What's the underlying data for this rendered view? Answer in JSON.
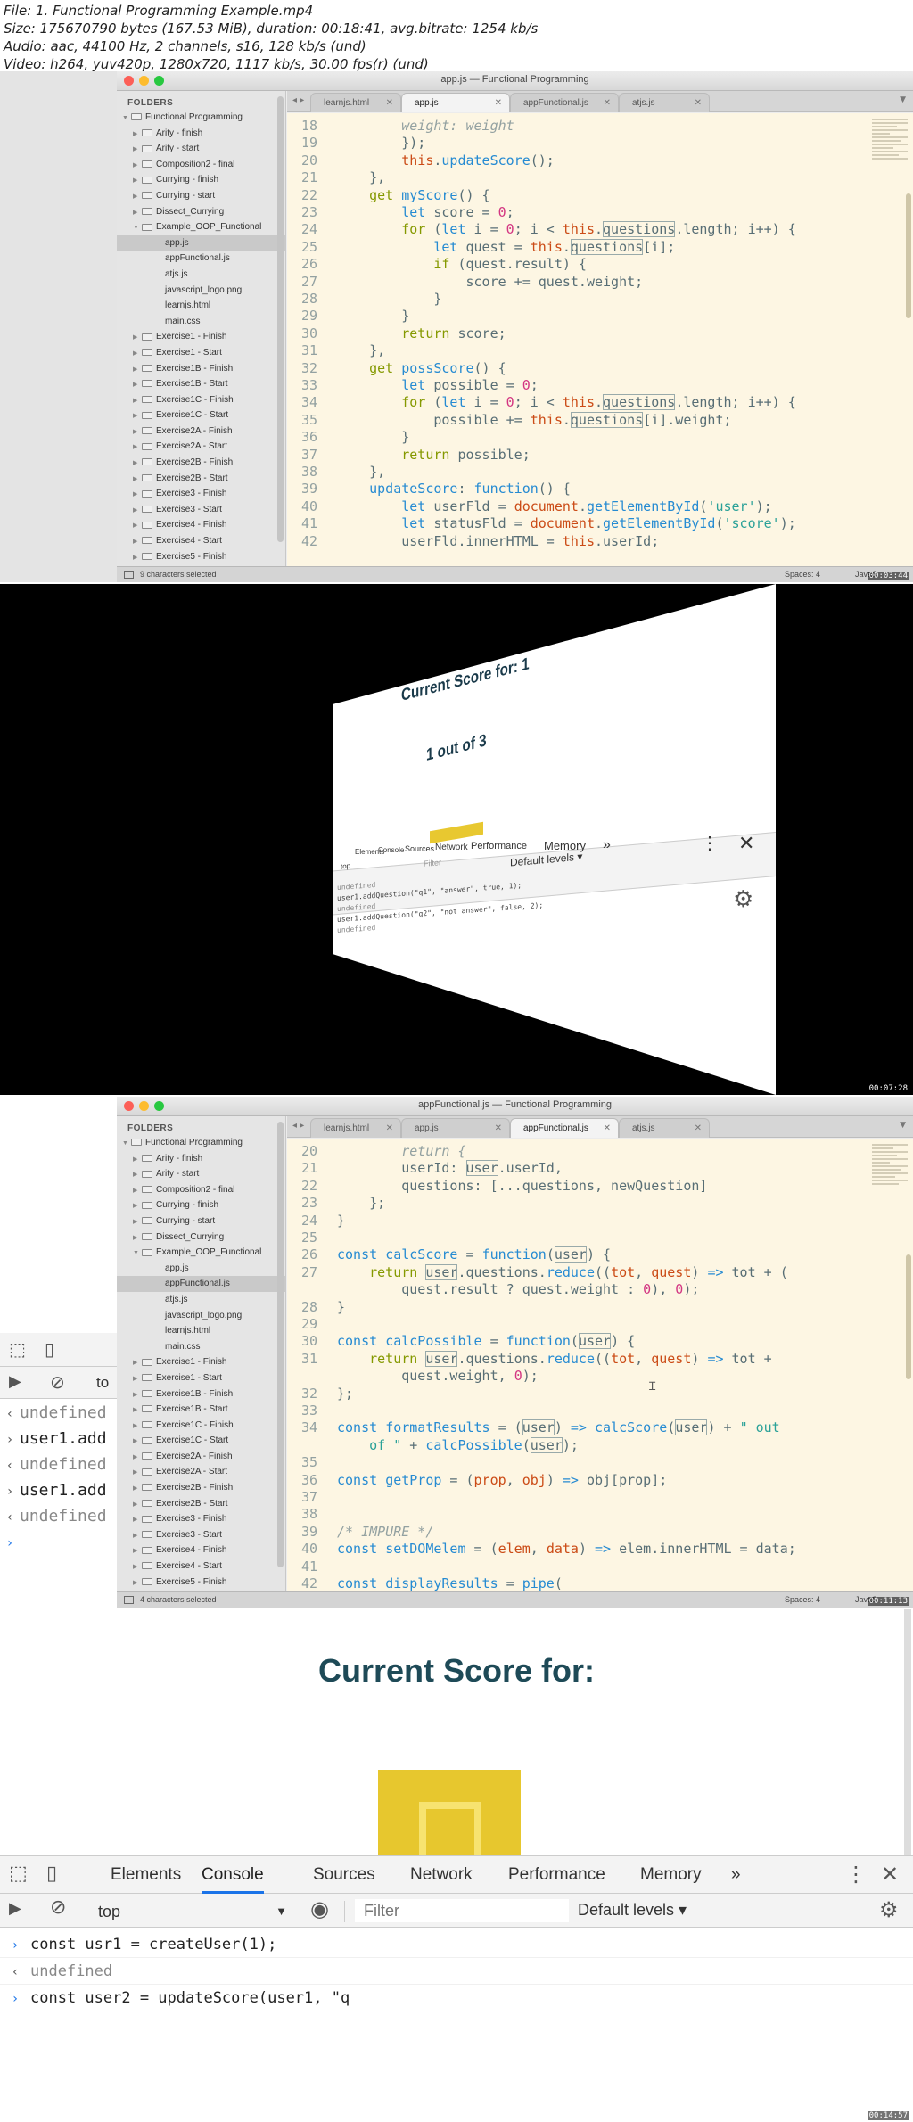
{
  "file_info": [
    "File: 1. Functional Programming Example.mp4",
    "Size: 175670790 bytes (167.53 MiB), duration: 00:18:41, avg.bitrate: 1254 kb/s",
    "Audio: aac, 44100 Hz, 2 channels, s16, 128 kb/s (und)",
    "Video: h264, yuv420p, 1280x720, 1117 kb/s, 30.00 fps(r) (und)"
  ],
  "sidebar": {
    "header": "FOLDERS",
    "root": "Functional Programming",
    "folders_before": [
      "Arity - finish",
      "Arity - start",
      "Composition2 - final",
      "Currying - finish",
      "Currying - start",
      "Dissect_Currying",
      "Example_OOP_Functional"
    ],
    "example_files": [
      "app.js",
      "appFunctional.js",
      "atjs.js",
      "javascript_logo.png",
      "learnjs.html",
      "main.css"
    ],
    "folders_after": [
      "Exercise1 - Finish",
      "Exercise1 - Start",
      "Exercise1B - Finish",
      "Exercise1B - Start",
      "Exercise1C - Finish",
      "Exercise1C - Start",
      "Exercise2A - Finish",
      "Exercise2A - Start",
      "Exercise2B - Finish",
      "Exercise2B - Start",
      "Exercise3 - Finish",
      "Exercise3 - Start",
      "Exercise4 - Finish",
      "Exercise4 - Start",
      "Exercise5 - Finish"
    ]
  },
  "editor1": {
    "title": "app.js — Functional Programming",
    "tabs": [
      "learnjs.html",
      "app.js",
      "appFunctional.js",
      "atjs.js"
    ],
    "active_tab": 1,
    "selected_file": "app.js",
    "status_left": "9 characters selected",
    "status_spaces": "Spaces: 4",
    "status_syntax": "JavaS",
    "lines": [
      [
        [
          "ln",
          "18"
        ],
        [
          "nm",
          "        "
        ],
        [
          "cm",
          "weight: weight"
        ]
      ],
      [
        [
          "ln",
          "19"
        ],
        [
          "nm",
          "        });"
        ]
      ],
      [
        [
          "ln",
          "20"
        ],
        [
          "nm",
          "        "
        ],
        [
          "t",
          "this"
        ],
        [
          "nm",
          "."
        ],
        [
          "fn",
          "updateScore"
        ],
        [
          "nm",
          "();"
        ]
      ],
      [
        [
          "ln",
          "21"
        ],
        [
          "nm",
          "    },"
        ]
      ],
      [
        [
          "ln",
          "22"
        ],
        [
          "nm",
          "    "
        ],
        [
          "k",
          "get "
        ],
        [
          "fn",
          "myScore"
        ],
        [
          "nm",
          "() {"
        ]
      ],
      [
        [
          "ln",
          "23"
        ],
        [
          "nm",
          "        "
        ],
        [
          "kw",
          "let "
        ],
        [
          "nm",
          "score = "
        ],
        [
          "n",
          "0"
        ],
        [
          "nm",
          ";"
        ]
      ],
      [
        [
          "ln",
          "24"
        ],
        [
          "nm",
          "        "
        ],
        [
          "k",
          "for "
        ],
        [
          "nm",
          "("
        ],
        [
          "kw",
          "let "
        ],
        [
          "nm",
          "i = "
        ],
        [
          "n",
          "0"
        ],
        [
          "nm",
          "; i < "
        ],
        [
          "t",
          "this"
        ],
        [
          "nm",
          "."
        ],
        [
          "box",
          "questions"
        ],
        [
          "nm",
          ".length; i++) {"
        ]
      ],
      [
        [
          "ln",
          "25"
        ],
        [
          "nm",
          "            "
        ],
        [
          "kw",
          "let "
        ],
        [
          "nm",
          "quest = "
        ],
        [
          "t",
          "this"
        ],
        [
          "nm",
          "."
        ],
        [
          "box",
          "questions"
        ],
        [
          "nm",
          "[i];"
        ]
      ],
      [
        [
          "ln",
          "26"
        ],
        [
          "nm",
          "            "
        ],
        [
          "k",
          "if "
        ],
        [
          "nm",
          "(quest.result) {"
        ]
      ],
      [
        [
          "ln",
          "27"
        ],
        [
          "nm",
          "                score += quest.weight;"
        ]
      ],
      [
        [
          "ln",
          "28"
        ],
        [
          "nm",
          "            }"
        ]
      ],
      [
        [
          "ln",
          "29"
        ],
        [
          "nm",
          "        }"
        ]
      ],
      [
        [
          "ln",
          "30"
        ],
        [
          "nm",
          "        "
        ],
        [
          "k",
          "return "
        ],
        [
          "nm",
          "score;"
        ]
      ],
      [
        [
          "ln",
          "31"
        ],
        [
          "nm",
          "    },"
        ]
      ],
      [
        [
          "ln",
          "32"
        ],
        [
          "nm",
          "    "
        ],
        [
          "k",
          "get "
        ],
        [
          "fn",
          "possScore"
        ],
        [
          "nm",
          "() {"
        ]
      ],
      [
        [
          "ln",
          "33"
        ],
        [
          "nm",
          "        "
        ],
        [
          "kw",
          "let "
        ],
        [
          "nm",
          "possible = "
        ],
        [
          "n",
          "0"
        ],
        [
          "nm",
          ";"
        ]
      ],
      [
        [
          "ln",
          "34"
        ],
        [
          "nm",
          "        "
        ],
        [
          "k",
          "for "
        ],
        [
          "nm",
          "("
        ],
        [
          "kw",
          "let "
        ],
        [
          "nm",
          "i = "
        ],
        [
          "n",
          "0"
        ],
        [
          "nm",
          "; i < "
        ],
        [
          "t",
          "this"
        ],
        [
          "nm",
          "."
        ],
        [
          "box",
          "questions"
        ],
        [
          "nm",
          ".length; i++) {"
        ]
      ],
      [
        [
          "ln",
          "35"
        ],
        [
          "nm",
          "            possible += "
        ],
        [
          "t",
          "this"
        ],
        [
          "nm",
          "."
        ],
        [
          "box",
          "questions"
        ],
        [
          "nm",
          "[i].weight;"
        ]
      ],
      [
        [
          "ln",
          "36"
        ],
        [
          "nm",
          "        }"
        ]
      ],
      [
        [
          "ln",
          "37"
        ],
        [
          "nm",
          "        "
        ],
        [
          "k",
          "return "
        ],
        [
          "nm",
          "possible;"
        ]
      ],
      [
        [
          "ln",
          "38"
        ],
        [
          "nm",
          "    },"
        ]
      ],
      [
        [
          "ln",
          "39"
        ],
        [
          "nm",
          "    "
        ],
        [
          "fn",
          "updateScore"
        ],
        [
          "nm",
          ": "
        ],
        [
          "kw",
          "function"
        ],
        [
          "nm",
          "() {"
        ]
      ],
      [
        [
          "ln",
          "40"
        ],
        [
          "nm",
          "        "
        ],
        [
          "kw",
          "let "
        ],
        [
          "nm",
          "userFld = "
        ],
        [
          "t",
          "document"
        ],
        [
          "nm",
          "."
        ],
        [
          "fn",
          "getElementById"
        ],
        [
          "nm",
          "("
        ],
        [
          "s",
          "'user'"
        ],
        [
          "nm",
          ");"
        ]
      ],
      [
        [
          "ln",
          "41"
        ],
        [
          "nm",
          "        "
        ],
        [
          "kw",
          "let "
        ],
        [
          "nm",
          "statusFld = "
        ],
        [
          "t",
          "document"
        ],
        [
          "nm",
          "."
        ],
        [
          "fn",
          "getElementById"
        ],
        [
          "nm",
          "("
        ],
        [
          "s",
          "'score'"
        ],
        [
          "nm",
          ");"
        ]
      ],
      [
        [
          "ln",
          "42"
        ],
        [
          "nm",
          "        userFld.innerHTML = "
        ],
        [
          "t",
          "this"
        ],
        [
          "nm",
          ".userId;"
        ]
      ]
    ]
  },
  "frame2": {
    "title": "Current Score for: 1",
    "subtitle": "1 out of 3",
    "devtools_tabs": [
      "Elements",
      "Console",
      "Sources",
      "Network",
      "Performance",
      "Memory"
    ],
    "top": "top",
    "filter_placeholder": "Filter",
    "levels": "Default levels ▾",
    "console": [
      "undefined",
      "user1.addQuestion(\"q1\", \"answer\", true, 1);",
      "undefined",
      "user1.addQuestion(\"q2\", \"not answer\", false, 2);",
      "undefined"
    ]
  },
  "editor2": {
    "title": "appFunctional.js — Functional Programming",
    "tabs": [
      "learnjs.html",
      "app.js",
      "appFunctional.js",
      "atjs.js"
    ],
    "active_tab": 2,
    "selected_file": "appFunctional.js",
    "status_left": "4 characters selected",
    "status_spaces": "Spaces: 4",
    "status_syntax": "JavaS",
    "lines": [
      [
        [
          "ln",
          "20"
        ],
        [
          "nm",
          "        "
        ],
        [
          "cm",
          "return {"
        ]
      ],
      [
        [
          "ln",
          "21"
        ],
        [
          "nm",
          "        userId: "
        ],
        [
          "box",
          "user"
        ],
        [
          "nm",
          ".userId,"
        ]
      ],
      [
        [
          "ln",
          "22"
        ],
        [
          "nm",
          "        questions: [...questions, newQuestion]"
        ]
      ],
      [
        [
          "ln",
          "23"
        ],
        [
          "nm",
          "    };"
        ]
      ],
      [
        [
          "ln",
          "24"
        ],
        [
          "nm",
          "}"
        ]
      ],
      [
        [
          "ln",
          "25"
        ],
        [
          "nm",
          ""
        ]
      ],
      [
        [
          "ln",
          "26"
        ],
        [
          "kw",
          "const "
        ],
        [
          "fn",
          "calcScore"
        ],
        [
          "nm",
          " = "
        ],
        [
          "kw",
          "function"
        ],
        [
          "nm",
          "("
        ],
        [
          "box",
          "user"
        ],
        [
          "nm",
          ") {"
        ]
      ],
      [
        [
          "ln",
          "27"
        ],
        [
          "nm",
          "    "
        ],
        [
          "k",
          "return "
        ],
        [
          "box",
          "user"
        ],
        [
          "nm",
          ".questions."
        ],
        [
          "fn",
          "reduce"
        ],
        [
          "nm",
          "(("
        ],
        [
          "t",
          "tot"
        ],
        [
          "nm",
          ", "
        ],
        [
          "t",
          "quest"
        ],
        [
          "nm",
          ") "
        ],
        [
          "kw",
          "=>"
        ],
        [
          "nm",
          " tot + ("
        ]
      ],
      [
        [
          "ln",
          ""
        ],
        [
          "nm",
          "        quest.result ? quest.weight : "
        ],
        [
          "n",
          "0"
        ],
        [
          "nm",
          "), "
        ],
        [
          "n",
          "0"
        ],
        [
          "nm",
          ");"
        ]
      ],
      [
        [
          "ln",
          "28"
        ],
        [
          "nm",
          "}"
        ]
      ],
      [
        [
          "ln",
          "29"
        ],
        [
          "nm",
          ""
        ]
      ],
      [
        [
          "ln",
          "30"
        ],
        [
          "kw",
          "const "
        ],
        [
          "fn",
          "calcPossible"
        ],
        [
          "nm",
          " = "
        ],
        [
          "kw",
          "function"
        ],
        [
          "nm",
          "("
        ],
        [
          "box",
          "user"
        ],
        [
          "nm",
          ") {"
        ]
      ],
      [
        [
          "ln",
          "31"
        ],
        [
          "nm",
          "    "
        ],
        [
          "k",
          "return "
        ],
        [
          "box",
          "user"
        ],
        [
          "nm",
          ".questions."
        ],
        [
          "fn",
          "reduce"
        ],
        [
          "nm",
          "(("
        ],
        [
          "t",
          "tot"
        ],
        [
          "nm",
          ", "
        ],
        [
          "t",
          "quest"
        ],
        [
          "nm",
          ") "
        ],
        [
          "kw",
          "=>"
        ],
        [
          "nm",
          " tot +"
        ]
      ],
      [
        [
          "ln",
          ""
        ],
        [
          "nm",
          "        quest.weight, "
        ],
        [
          "n",
          "0"
        ],
        [
          "nm",
          ");"
        ]
      ],
      [
        [
          "ln",
          "32"
        ],
        [
          "nm",
          "};"
        ]
      ],
      [
        [
          "ln",
          "33"
        ],
        [
          "nm",
          ""
        ]
      ],
      [
        [
          "ln",
          "34"
        ],
        [
          "kw",
          "const "
        ],
        [
          "fn",
          "formatResults"
        ],
        [
          "nm",
          " = ("
        ],
        [
          "box",
          "user"
        ],
        [
          "nm",
          ") "
        ],
        [
          "kw",
          "=>"
        ],
        [
          "nm",
          " "
        ],
        [
          "fn",
          "calcScore"
        ],
        [
          "nm",
          "("
        ],
        [
          "box",
          "user"
        ],
        [
          "nm",
          ") + "
        ],
        [
          "s",
          "\" out"
        ]
      ],
      [
        [
          "ln",
          ""
        ],
        [
          "s",
          "    of \""
        ],
        [
          "nm",
          " + "
        ],
        [
          "fn",
          "calcPossible"
        ],
        [
          "nm",
          "("
        ],
        [
          "box",
          "user"
        ],
        [
          "nm",
          ");"
        ]
      ],
      [
        [
          "ln",
          "35"
        ],
        [
          "nm",
          ""
        ]
      ],
      [
        [
          "ln",
          "36"
        ],
        [
          "kw",
          "const "
        ],
        [
          "fn",
          "getProp"
        ],
        [
          "nm",
          " = ("
        ],
        [
          "t",
          "prop"
        ],
        [
          "nm",
          ", "
        ],
        [
          "t",
          "obj"
        ],
        [
          "nm",
          ") "
        ],
        [
          "kw",
          "=>"
        ],
        [
          "nm",
          " obj[prop];"
        ]
      ],
      [
        [
          "ln",
          "37"
        ],
        [
          "nm",
          ""
        ]
      ],
      [
        [
          "ln",
          "38"
        ],
        [
          "nm",
          ""
        ]
      ],
      [
        [
          "ln",
          "39"
        ],
        [
          "cm",
          "/* IMPURE */"
        ]
      ],
      [
        [
          "ln",
          "40"
        ],
        [
          "kw",
          "const "
        ],
        [
          "fn",
          "setDOMelem"
        ],
        [
          "nm",
          " = ("
        ],
        [
          "t",
          "elem"
        ],
        [
          "nm",
          ", "
        ],
        [
          "t",
          "data"
        ],
        [
          "nm",
          ") "
        ],
        [
          "kw",
          "=>"
        ],
        [
          "nm",
          " elem.innerHTML = data;"
        ]
      ],
      [
        [
          "ln",
          "41"
        ],
        [
          "nm",
          ""
        ]
      ],
      [
        [
          "ln",
          "42"
        ],
        [
          "kw",
          "const "
        ],
        [
          "fn",
          "displayResults"
        ],
        [
          "nm",
          " = "
        ],
        [
          "fn",
          "pipe"
        ],
        [
          "nm",
          "("
        ]
      ]
    ]
  },
  "strip": {
    "lines": [
      [
        "und",
        "undefined"
      ],
      [
        "cmd",
        "user1.add"
      ],
      [
        "und",
        "undefined"
      ],
      [
        "cmd",
        "user1.add"
      ],
      [
        "und",
        "undefined"
      ],
      [
        "cmd",
        ""
      ]
    ],
    "top_label": "to"
  },
  "frame4": {
    "title": "Current Score for:",
    "devtools_tabs": [
      "Elements",
      "Console",
      "Sources",
      "Network",
      "Performance",
      "Memory"
    ],
    "more": "»",
    "context": "top",
    "filter_placeholder": "Filter",
    "levels": "Default levels ▾",
    "console": [
      [
        "cmd",
        "const usr1 = createUser(1);"
      ],
      [
        "und",
        "undefined"
      ],
      [
        "cmd",
        "const user2 = updateScore(user1, \"q"
      ]
    ]
  },
  "timestamps": [
    "00:03:44",
    "00:07:28",
    "00:11:13",
    "00:14:57"
  ]
}
